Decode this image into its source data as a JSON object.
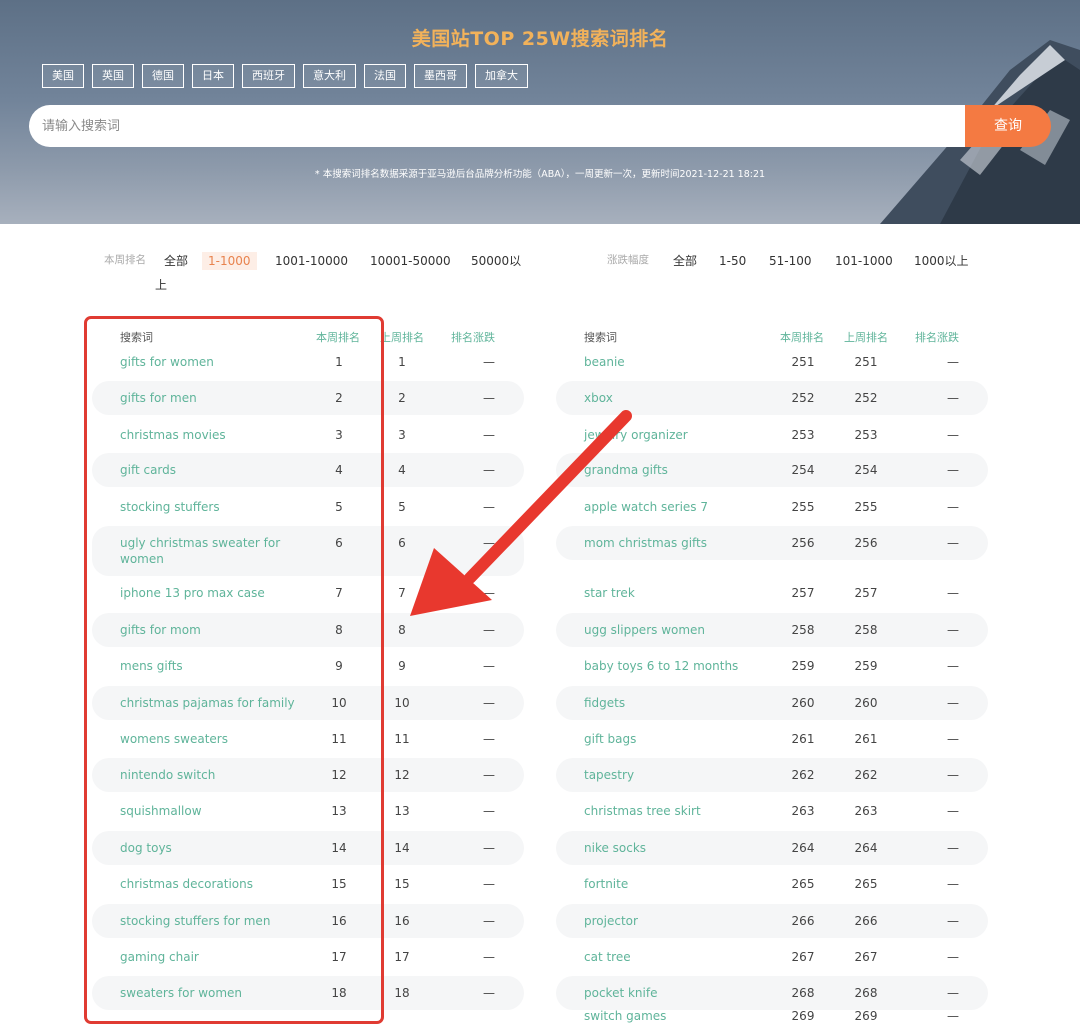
{
  "hero": {
    "title": "美国站TOP 25W搜索词排名",
    "countries": [
      "美国",
      "英国",
      "德国",
      "日本",
      "西班牙",
      "意大利",
      "法国",
      "墨西哥",
      "加拿大"
    ],
    "search_placeholder": "请输入搜索词",
    "search_button": "查询",
    "note": "* 本搜索词排名数据采源于亚马逊后台品牌分析功能（ABA），一周更新一次，更新时间2021-12-21 18:21"
  },
  "filters": {
    "rank_label": "本周排名",
    "rank_options": [
      "全部",
      "1-1000",
      "1001-10000",
      "10001-50000",
      "50000以",
      "上"
    ],
    "rank_active": "1-1000",
    "change_label": "涨跌幅度",
    "change_options": [
      "全部",
      "1-50",
      "51-100",
      "101-1000",
      "1000以上"
    ]
  },
  "table_headers": {
    "keyword": "搜索词",
    "this_week": "本周排名",
    "last_week": "上周排名",
    "change": "排名涨跌"
  },
  "left_rows": [
    {
      "kw": "gifts for women",
      "tw": "1",
      "lw": "1",
      "ch": "—"
    },
    {
      "kw": "gifts for men",
      "tw": "2",
      "lw": "2",
      "ch": "—"
    },
    {
      "kw": "christmas movies",
      "tw": "3",
      "lw": "3",
      "ch": "—"
    },
    {
      "kw": "gift cards",
      "tw": "4",
      "lw": "4",
      "ch": "—"
    },
    {
      "kw": "stocking stuffers",
      "tw": "5",
      "lw": "5",
      "ch": "—"
    },
    {
      "kw": "ugly christmas sweater for",
      "kw2": "women",
      "tw": "6",
      "lw": "6",
      "ch": "—"
    },
    {
      "kw": "iphone 13 pro max case",
      "tw": "7",
      "lw": "7",
      "ch": "—"
    },
    {
      "kw": "gifts for mom",
      "tw": "8",
      "lw": "8",
      "ch": "—"
    },
    {
      "kw": "mens gifts",
      "tw": "9",
      "lw": "9",
      "ch": "—"
    },
    {
      "kw": "christmas pajamas for family",
      "tw": "10",
      "lw": "10",
      "ch": "—"
    },
    {
      "kw": "womens sweaters",
      "tw": "11",
      "lw": "11",
      "ch": "—"
    },
    {
      "kw": "nintendo switch",
      "tw": "12",
      "lw": "12",
      "ch": "—"
    },
    {
      "kw": "squishmallow",
      "tw": "13",
      "lw": "13",
      "ch": "—"
    },
    {
      "kw": "dog toys",
      "tw": "14",
      "lw": "14",
      "ch": "—"
    },
    {
      "kw": "christmas decorations",
      "tw": "15",
      "lw": "15",
      "ch": "—"
    },
    {
      "kw": "stocking stuffers for men",
      "tw": "16",
      "lw": "16",
      "ch": "—"
    },
    {
      "kw": "gaming chair",
      "tw": "17",
      "lw": "17",
      "ch": "—"
    },
    {
      "kw": "sweaters for women",
      "tw": "18",
      "lw": "18",
      "ch": "—"
    }
  ],
  "right_rows": [
    {
      "kw": "beanie",
      "tw": "251",
      "lw": "251",
      "ch": "—"
    },
    {
      "kw": "xbox",
      "tw": "252",
      "lw": "252",
      "ch": "—"
    },
    {
      "kw": "jewelry organizer",
      "tw": "253",
      "lw": "253",
      "ch": "—"
    },
    {
      "kw": "grandma gifts",
      "tw": "254",
      "lw": "254",
      "ch": "—"
    },
    {
      "kw": "apple watch series 7",
      "tw": "255",
      "lw": "255",
      "ch": "—"
    },
    {
      "kw": "mom christmas gifts",
      "tw": "256",
      "lw": "256",
      "ch": "—"
    },
    {
      "kw": "star trek",
      "tw": "257",
      "lw": "257",
      "ch": "—"
    },
    {
      "kw": "ugg slippers women",
      "tw": "258",
      "lw": "258",
      "ch": "—"
    },
    {
      "kw": "baby toys 6 to 12 months",
      "tw": "259",
      "lw": "259",
      "ch": "—"
    },
    {
      "kw": "fidgets",
      "tw": "260",
      "lw": "260",
      "ch": "—"
    },
    {
      "kw": "gift bags",
      "tw": "261",
      "lw": "261",
      "ch": "—"
    },
    {
      "kw": "tapestry",
      "tw": "262",
      "lw": "262",
      "ch": "—"
    },
    {
      "kw": "christmas tree skirt",
      "tw": "263",
      "lw": "263",
      "ch": "—"
    },
    {
      "kw": "nike socks",
      "tw": "264",
      "lw": "264",
      "ch": "—"
    },
    {
      "kw": "fortnite",
      "tw": "265",
      "lw": "265",
      "ch": "—"
    },
    {
      "kw": "projector",
      "tw": "266",
      "lw": "266",
      "ch": "—"
    },
    {
      "kw": "cat tree",
      "tw": "267",
      "lw": "267",
      "ch": "—"
    },
    {
      "kw": "pocket knife",
      "tw": "268",
      "lw": "268",
      "ch": "—"
    },
    {
      "kw": "switch games",
      "tw": "269",
      "lw": "269",
      "ch": "—"
    }
  ],
  "colors": {
    "accent": "#f47a42",
    "title": "#f2b25a",
    "keyword": "#5fb49a",
    "highlight": "#e03b32"
  }
}
